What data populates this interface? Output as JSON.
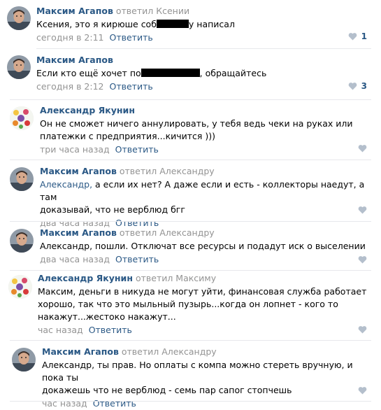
{
  "comments": [
    {
      "author": "Максим Агапов",
      "reply_to": "ответил Ксении",
      "text_a": "Ксения, это я кирюше соб",
      "text_b": "у написал",
      "time": "сегодня в 2:11",
      "reply_label": "Ответить",
      "likes": "1"
    },
    {
      "author": "Максим Агапов",
      "reply_to": "",
      "text_a": "Если кто ещё хочет по",
      "text_b": ", обращайтесь",
      "time": "сегодня в 2:12",
      "reply_label": "Ответить",
      "likes": "3"
    },
    {
      "author": "Александр Якунин",
      "reply_to": "",
      "text_1": "Он не сможет ничего аннулировать, у тебя ведь чеки на руках или",
      "text_2": "платежки с предприятия...кичится )))",
      "time": "три часа назад",
      "reply_label": "Ответить",
      "likes": ""
    },
    {
      "author": "Максим Агапов",
      "reply_to": "ответил Александру",
      "mention": "Александр,",
      "text_1": " а если их нет? А даже если и есть - коллекторы наедут, а там",
      "text_2": "доказывай, что не верблюд бгг",
      "time": "два часа назад",
      "reply_label": "Ответить",
      "likes": ""
    },
    {
      "author": "Максим Агапов",
      "reply_to": "ответил Александру",
      "text_1": "Александр, пошли. Отключат все ресурсы и подадут иск о выселении",
      "time": "два часа назад",
      "reply_label": "Ответить",
      "likes": ""
    },
    {
      "author": "Александр Якунин",
      "reply_to": "ответил Максиму",
      "text_1": "Максим, деньги в никуда не могут уйти, финансовая служба работает",
      "text_2": "хорошо, так что это мыльный пузырь...когда он лопнет - кого то",
      "text_3": "накажут...жестоко накажут...",
      "time": "час назад",
      "reply_label": "Ответить",
      "likes": ""
    },
    {
      "author": "Максим Агапов",
      "reply_to": "ответил Александру",
      "text_1": "Александр, ты прав. Но оплаты с компа можно стереть вручную, и пока ты",
      "text_2": "докажешь что не верблюд - семь пар сапог стопчешь",
      "time": "час назад",
      "reply_label": "Ответить",
      "likes": ""
    }
  ],
  "colors": {
    "link": "#2a5885",
    "muted": "#939393",
    "separator": "#e7e8ec",
    "heart": "#b4bfcc"
  },
  "icons": {
    "like": "heart-icon",
    "avatar_man": "man-portrait",
    "avatar_flowers": "flowers-image"
  }
}
